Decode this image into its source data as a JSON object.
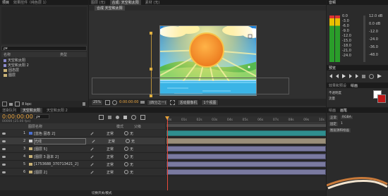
{
  "app": {
    "menu_tabs": [
      "项目",
      "效果控件（纯色层 1）"
    ],
    "comp_tabs": [
      "图层 (无)",
      "合成 天空和太阳",
      "素材 (无)"
    ],
    "comp_tab_title": "合成: 天空和太阳"
  },
  "project": {
    "search_placeholder": "ρ▾",
    "col_name": "名称",
    "col_type": "类型",
    "items": [
      "天空和太阳",
      "天空和太阳 2",
      "固态层",
      "图层"
    ],
    "footer_bpc": "8 bpc"
  },
  "viewer": {
    "zoom": "25%",
    "resolution": "(四分之一)",
    "view": "活动摄像机",
    "views": "1个视图",
    "timecode": "0:00:00:00"
  },
  "info": {
    "title": "音频",
    "db_left": [
      "0.0",
      "-3.0",
      "-6.0",
      "-9.0",
      "-12.0",
      "-15.0",
      "-18.0",
      "-21.0",
      "-24.0"
    ],
    "db_right": [
      "12.0 dB",
      "0.0 dB",
      "-12.0",
      "-24.0",
      "-36.0",
      "-48.0"
    ]
  },
  "preview": {
    "title": "预览",
    "effects_title": "效果和预设",
    "paint_title": "绘画",
    "brush_title": "画笔",
    "brush_opacity": "不透明度",
    "brush_flow": "流量",
    "brush_mode": "正常",
    "brush_channel": "RGBA",
    "duration": "固定",
    "duration_val": "1",
    "erase": "图层源和绘画"
  },
  "timeline": {
    "tabs": [
      "渲染队列",
      "天空和太阳",
      "天空和太阳 2"
    ],
    "timecode": "0:00:00:00",
    "fps_text": "00000 (25.00 fps)",
    "col_layer_name": "图层名称",
    "col_mode": "模式",
    "col_parent": "父级",
    "ruler": [
      "0s",
      "01s",
      "02s",
      "03s",
      "04s",
      "05s",
      "06s",
      "07s",
      "08s",
      "09s",
      "10s"
    ],
    "layers": [
      {
        "num": "1",
        "name": "[蓝色 固态 2]",
        "mode": "正常",
        "parent": "无"
      },
      {
        "num": "2",
        "name": "光线",
        "mode": "正常",
        "parent": "无"
      },
      {
        "num": "3",
        "name": "[图层 5]",
        "mode": "正常",
        "parent": "无"
      },
      {
        "num": "4",
        "name": "[图层 3 副本 2]",
        "mode": "正常",
        "parent": "无"
      },
      {
        "num": "5",
        "name": "[1753688_370713421_2]",
        "mode": "正常",
        "parent": "无"
      },
      {
        "num": "6",
        "name": "[图层 2]",
        "mode": "正常",
        "parent": "无"
      }
    ],
    "footer": "切换开关/模式"
  },
  "colors": {
    "accent": "#e8a33a",
    "timecode": "#e9a540",
    "sky": "#2a8ed8",
    "sun": "#f08a28",
    "grass": "#4cb84a",
    "water": "#3bb4e6",
    "bar_blue": "#7a7aa0",
    "bar_tan": "#9a8f7a"
  }
}
